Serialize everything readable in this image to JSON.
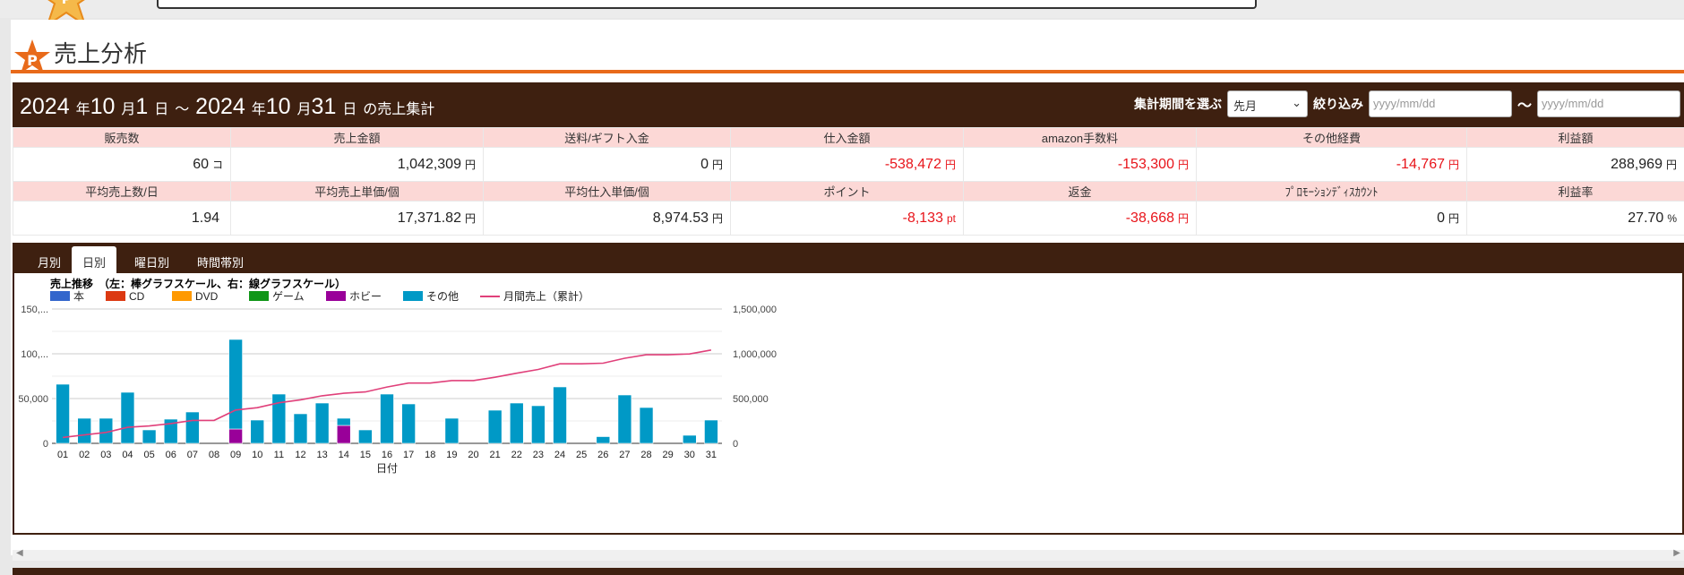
{
  "page": {
    "title": "売上分析"
  },
  "period": {
    "start_year": "2024",
    "start_month": "10",
    "start_day": "1",
    "end_year": "2024",
    "end_month": "10",
    "end_day": "31",
    "unit_year": "年",
    "unit_month": "月",
    "unit_day": "日",
    "tilde": "～",
    "suffix": "の売上集計",
    "select_label": "集計期間を選ぶ",
    "select_value": "先月",
    "filter_label": "絞り込み",
    "date_placeholder": "yyyy/mm/dd",
    "date_sep": "～"
  },
  "stats": {
    "row1_headers": [
      "販売数",
      "売上金額",
      "送料/ギフト入金",
      "仕入金額",
      "amazon手数料",
      "その他経費",
      "利益額"
    ],
    "row1_values": [
      {
        "value": "60",
        "unit": "コ"
      },
      {
        "value": "1,042,309",
        "unit": "円"
      },
      {
        "value": "0",
        "unit": "円"
      },
      {
        "value": "-538,472",
        "unit": "円"
      },
      {
        "value": "-153,300",
        "unit": "円"
      },
      {
        "value": "-14,767",
        "unit": "円"
      },
      {
        "value": "288,969",
        "unit": "円"
      }
    ],
    "row2_headers": [
      "平均売上数/日",
      "平均売上単価/個",
      "平均仕入単価/個",
      "ポイント",
      "返金",
      "ﾌﾟﾛﾓｰｼｮﾝﾃﾞｨｽｶｳﾝﾄ",
      "利益率"
    ],
    "row2_values": [
      {
        "value": "1.94",
        "unit": ""
      },
      {
        "value": "17,371.82",
        "unit": "円"
      },
      {
        "value": "8,974.53",
        "unit": "円"
      },
      {
        "value": "-8,133",
        "unit": "pt"
      },
      {
        "value": "-38,668",
        "unit": "円"
      },
      {
        "value": "0",
        "unit": "円"
      },
      {
        "value": "27.70",
        "unit": "%"
      }
    ]
  },
  "tabs": [
    "月別",
    "日別",
    "曜日別",
    "時間帯別"
  ],
  "active_tab": 1,
  "colors": {
    "header_bg": "#3e2010",
    "accent_orange": "#e86a1a",
    "stat_header_bg": "#fcd8d6",
    "negative": "#e8141a"
  },
  "chart_data": {
    "type": "bar",
    "title": "売上推移　（左：棒グラフスケール、右：線グラフスケール）",
    "xlabel": "日付",
    "ylabel": "",
    "categories": [
      "01",
      "02",
      "03",
      "04",
      "05",
      "06",
      "07",
      "08",
      "09",
      "10",
      "11",
      "12",
      "13",
      "14",
      "15",
      "16",
      "17",
      "18",
      "19",
      "20",
      "21",
      "22",
      "23",
      "24",
      "25",
      "26",
      "27",
      "28",
      "29",
      "30",
      "31"
    ],
    "ylim": [
      0,
      150000
    ],
    "y_ticks": [
      "0",
      "50,000",
      "100,...",
      "150,..."
    ],
    "y2lim": [
      0,
      1500000
    ],
    "y2_ticks": [
      "0",
      "500,000",
      "1,000,000",
      "1,500,000"
    ],
    "stacked": true,
    "series": [
      {
        "name": "本",
        "color": "#3366cc",
        "values": [
          0,
          0,
          0,
          0,
          0,
          0,
          0,
          0,
          0,
          0,
          0,
          0,
          0,
          0,
          0,
          0,
          0,
          0,
          0,
          0,
          0,
          0,
          0,
          0,
          0,
          0,
          0,
          0,
          0,
          0,
          0
        ]
      },
      {
        "name": "CD",
        "color": "#dc3912",
        "values": [
          0,
          0,
          0,
          0,
          0,
          0,
          0,
          0,
          0,
          0,
          0,
          0,
          0,
          0,
          0,
          0,
          0,
          0,
          0,
          0,
          0,
          0,
          0,
          0,
          0,
          0,
          0,
          0,
          0,
          0,
          0
        ]
      },
      {
        "name": "DVD",
        "color": "#ff9900",
        "values": [
          0,
          0,
          0,
          0,
          0,
          0,
          0,
          0,
          0,
          0,
          0,
          0,
          0,
          0,
          0,
          0,
          0,
          0,
          0,
          0,
          0,
          0,
          0,
          0,
          0,
          0,
          0,
          0,
          0,
          0,
          0
        ]
      },
      {
        "name": "ゲーム",
        "color": "#109618",
        "values": [
          0,
          0,
          0,
          0,
          0,
          0,
          0,
          0,
          0,
          0,
          0,
          0,
          0,
          0,
          0,
          0,
          0,
          0,
          0,
          0,
          0,
          0,
          0,
          0,
          0,
          0,
          0,
          0,
          0,
          0,
          0
        ]
      },
      {
        "name": "ホビー",
        "color": "#990099",
        "values": [
          0,
          0,
          0,
          0,
          0,
          0,
          0,
          0,
          16000,
          0,
          0,
          0,
          0,
          20000,
          0,
          0,
          0,
          0,
          0,
          0,
          0,
          0,
          0,
          0,
          0,
          0,
          0,
          0,
          0,
          0,
          0
        ]
      },
      {
        "name": "その他",
        "color": "#0099c6",
        "values": [
          66000,
          28000,
          28000,
          57000,
          15000,
          27000,
          35000,
          0,
          100000,
          26000,
          55000,
          33000,
          45000,
          8000,
          15000,
          55000,
          44000,
          0,
          28000,
          0,
          37000,
          45000,
          42000,
          63000,
          0,
          7500,
          54000,
          40000,
          0,
          9000,
          26000
        ]
      }
    ],
    "line_series": {
      "name": "月間売上（累計）",
      "color": "#e0407a",
      "axis": "right",
      "values": [
        66000,
        94000,
        122000,
        179000,
        194000,
        221000,
        256000,
        256000,
        372000,
        398000,
        453000,
        486000,
        531000,
        559000,
        574000,
        629000,
        673000,
        673000,
        701000,
        701000,
        738000,
        783000,
        825000,
        888000,
        888000,
        895500,
        949500,
        989500,
        989500,
        998500,
        1042309
      ]
    }
  }
}
